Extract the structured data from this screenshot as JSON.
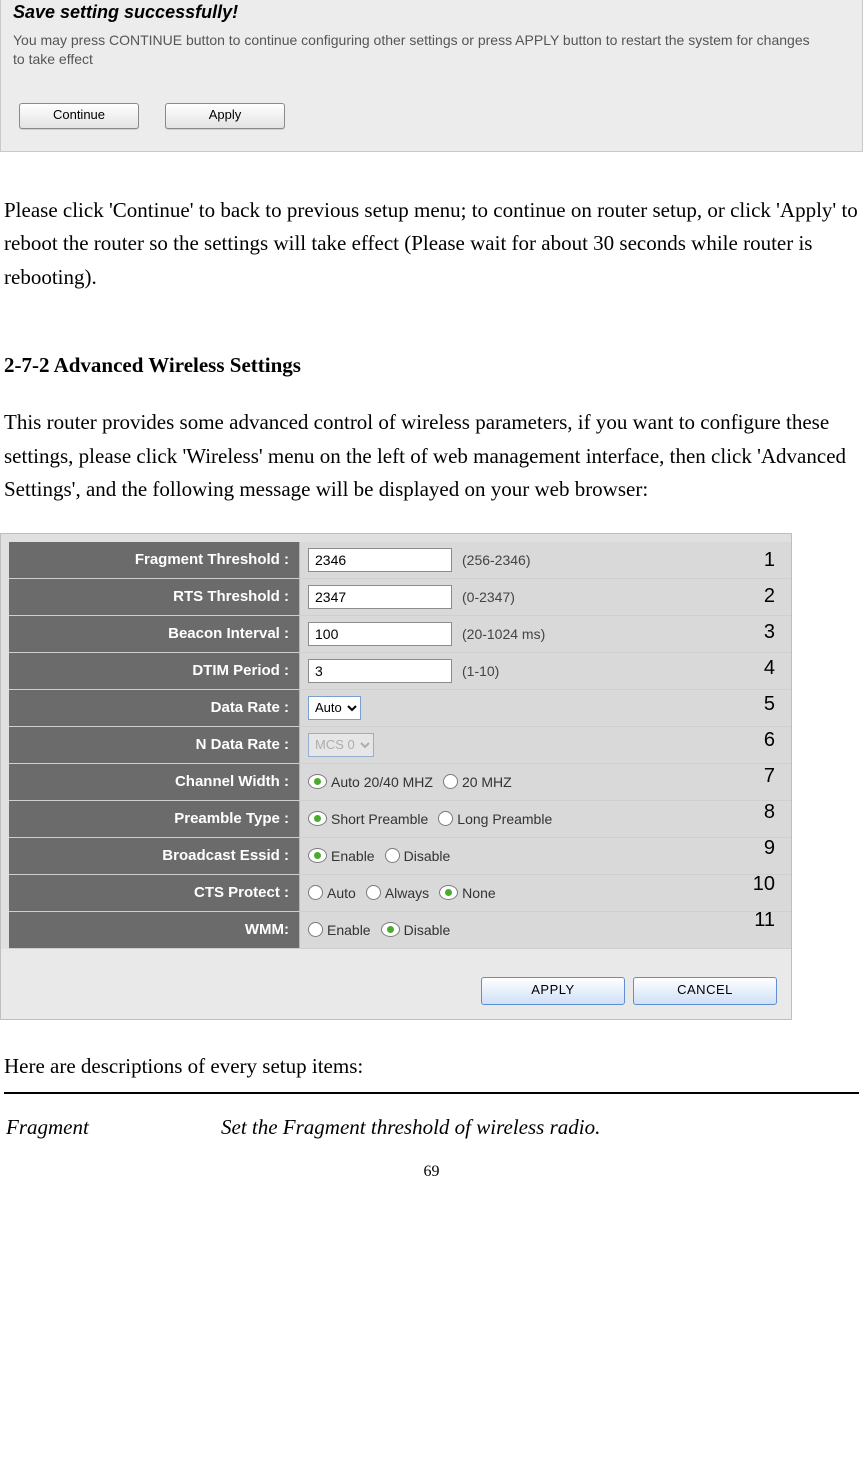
{
  "dialog": {
    "title": "Save setting successfully!",
    "message": "You may press CONTINUE button to continue configuring other settings or press APPLY button to restart the system for changes to take effect",
    "continue_label": "Continue",
    "apply_label": "Apply"
  },
  "paragraphs": {
    "after_dialog": "Please click 'Continue' to back to previous setup menu; to continue on router setup, or click 'Apply' to reboot the router so the settings will take effect (Please wait for about 30 seconds while router is rebooting).",
    "section_heading": "2-7-2 Advanced Wireless Settings",
    "section_intro": "This router provides some advanced control of wireless parameters, if you want to configure these settings, please click 'Wireless' menu on the left of web management interface, then click 'Advanced Settings', and the following message will be displayed on your web browser:",
    "desc_intro": "Here are descriptions of every setup items:"
  },
  "settings": {
    "rows": [
      {
        "label": "Fragment Threshold :",
        "type": "text",
        "value": "2346",
        "hint": "(256-2346)",
        "callout": "1"
      },
      {
        "label": "RTS Threshold :",
        "type": "text",
        "value": "2347",
        "hint": "(0-2347)",
        "callout": "2"
      },
      {
        "label": "Beacon Interval :",
        "type": "text",
        "value": "100",
        "hint": "(20-1024 ms)",
        "callout": "3"
      },
      {
        "label": "DTIM Period :",
        "type": "text",
        "value": "3",
        "hint": "(1-10)",
        "callout": "4"
      },
      {
        "label": "Data Rate :",
        "type": "select",
        "value": "Auto",
        "callout": "5"
      },
      {
        "label": "N Data Rate :",
        "type": "select_disabled",
        "value": "MCS 0",
        "callout": "6"
      },
      {
        "label": "Channel Width :",
        "type": "radio",
        "options": [
          {
            "label": "Auto 20/40 MHZ",
            "selected": true
          },
          {
            "label": "20 MHZ",
            "selected": false
          }
        ],
        "callout": "7"
      },
      {
        "label": "Preamble Type :",
        "type": "radio",
        "options": [
          {
            "label": "Short Preamble",
            "selected": true
          },
          {
            "label": "Long Preamble",
            "selected": false
          }
        ],
        "callout": "8"
      },
      {
        "label": "Broadcast Essid :",
        "type": "radio",
        "options": [
          {
            "label": "Enable",
            "selected": true
          },
          {
            "label": "Disable",
            "selected": false
          }
        ],
        "callout": "9"
      },
      {
        "label": "CTS Protect :",
        "type": "radio",
        "options": [
          {
            "label": "Auto",
            "selected": false
          },
          {
            "label": "Always",
            "selected": false
          },
          {
            "label": "None",
            "selected": true
          }
        ],
        "callout": "10"
      },
      {
        "label": "WMM:",
        "type": "radio",
        "options": [
          {
            "label": "Enable",
            "selected": false
          },
          {
            "label": "Disable",
            "selected": true
          }
        ],
        "callout": "11"
      }
    ],
    "apply_label": "APPLY",
    "cancel_label": "CANCEL"
  },
  "description_table": {
    "term": "Fragment",
    "definition": "Set the Fragment threshold of wireless radio."
  },
  "page_number": "69"
}
